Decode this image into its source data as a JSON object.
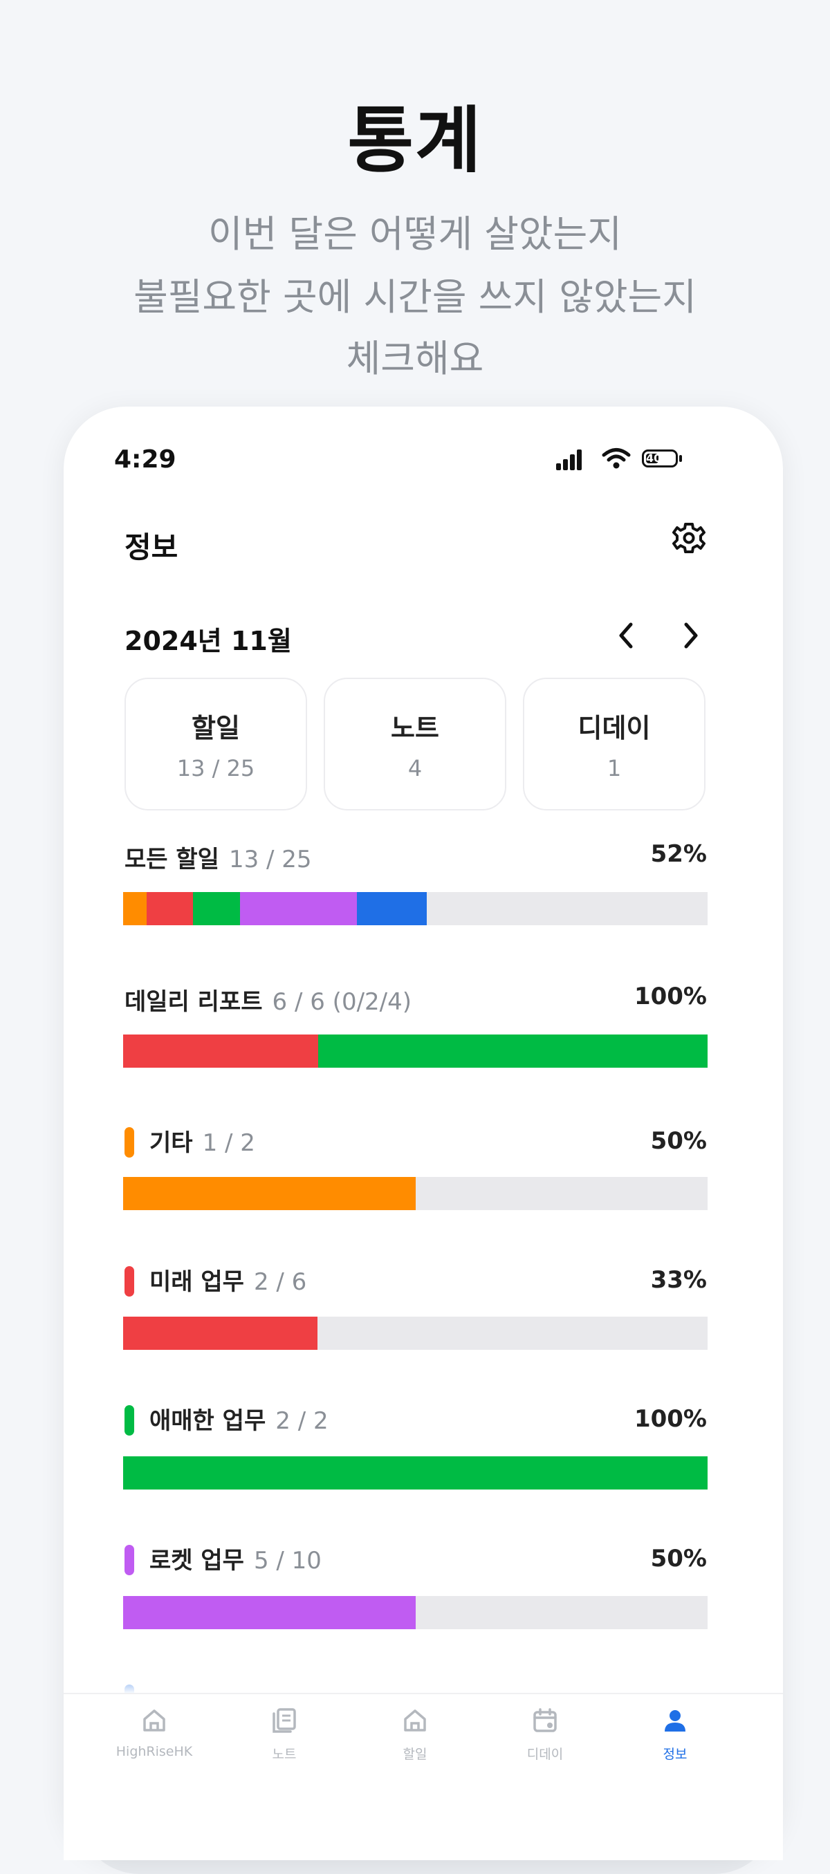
{
  "promo": {
    "title": "통계",
    "lines": [
      "이번 달은 어떻게 살았는지",
      "불필요한 곳에 시간을 쓰지 않았는지",
      "체크해요"
    ]
  },
  "status": {
    "time": "4:29",
    "battery_level": "40"
  },
  "header": {
    "title": "정보",
    "settings_icon": "gear-icon"
  },
  "month": {
    "label": "2024년 11월",
    "prev_icon": "chevron-left-icon",
    "next_icon": "chevron-right-icon"
  },
  "cards": [
    {
      "label": "할일",
      "value": "13 / 25"
    },
    {
      "label": "노트",
      "value": "4"
    },
    {
      "label": "디데이",
      "value": "1"
    }
  ],
  "all_tasks": {
    "label": "모든 할일",
    "count": "13 / 25",
    "percent": "52%",
    "segments": [
      {
        "color": "#ff8c00",
        "value": 1
      },
      {
        "color": "#ef3f43",
        "value": 2
      },
      {
        "color": "#00bb44",
        "value": 2
      },
      {
        "color": "#c05cf2",
        "value": 5
      },
      {
        "color": "#1f6fe6",
        "value": 3
      }
    ],
    "total": 25
  },
  "daily_report": {
    "label": "데일리 리포트",
    "count": "6 / 6 (0/2/4)",
    "percent": "100%",
    "segments": [
      {
        "color": "#ef3f43",
        "value": 2
      },
      {
        "color": "#00bb44",
        "value": 4
      }
    ],
    "total": 6
  },
  "categories": [
    {
      "label": "기타",
      "count": "1 / 2",
      "percent": "50%",
      "color": "#ff8c00",
      "fraction": 0.5
    },
    {
      "label": "미래 업무",
      "count": "2 / 6",
      "percent": "33%",
      "color": "#ef3f43",
      "fraction": 0.333
    },
    {
      "label": "애매한 업무",
      "count": "2 / 2",
      "percent": "100%",
      "color": "#00bb44",
      "fraction": 1.0
    },
    {
      "label": "로켓 업무",
      "count": "5 / 10",
      "percent": "50%",
      "color": "#c05cf2",
      "fraction": 0.5
    }
  ],
  "tabs": [
    {
      "label": "HighRiseHK",
      "icon": "home-icon",
      "active": false
    },
    {
      "label": "노트",
      "icon": "notes-icon",
      "active": false
    },
    {
      "label": "할일",
      "icon": "home-icon",
      "active": false
    },
    {
      "label": "디데이",
      "icon": "calendar-icon",
      "active": false
    },
    {
      "label": "정보",
      "icon": "person-icon",
      "active": true
    }
  ]
}
